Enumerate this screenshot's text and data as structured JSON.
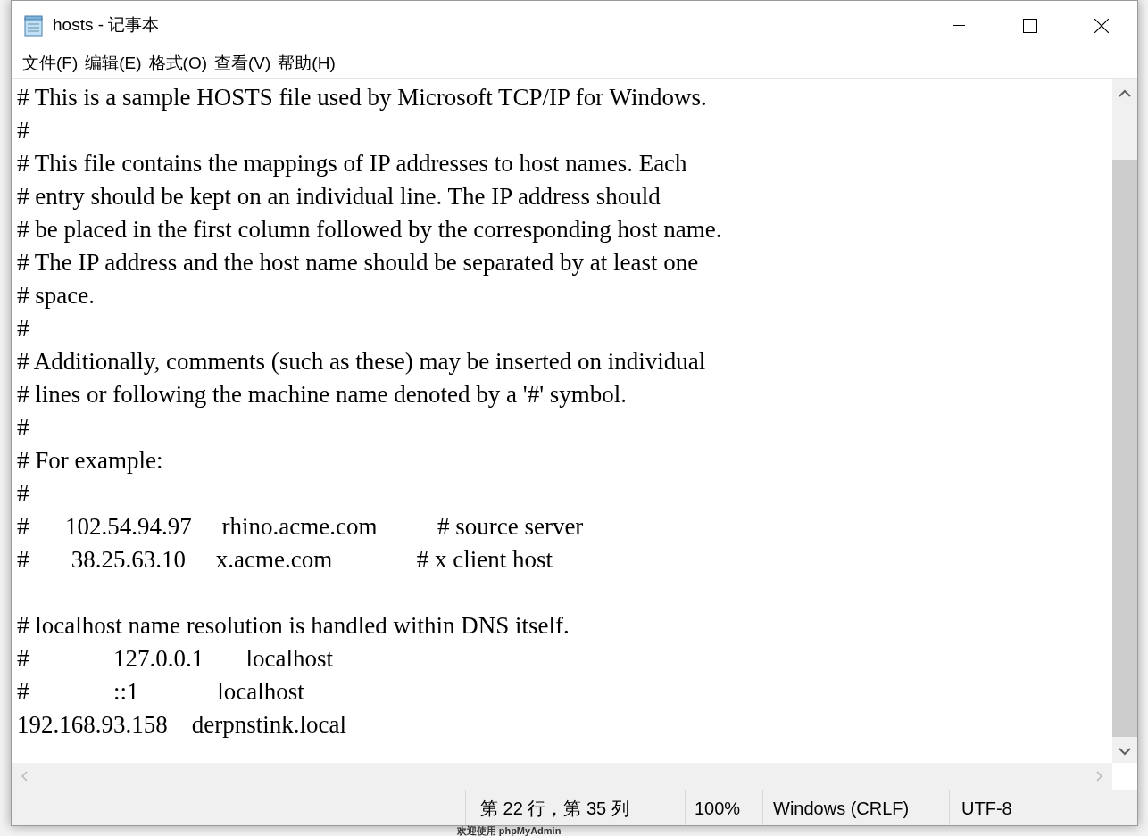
{
  "window": {
    "title": "hosts - 记事本"
  },
  "menu": [
    {
      "label": "文件(F)"
    },
    {
      "label": "编辑(E)"
    },
    {
      "label": "格式(O)"
    },
    {
      "label": "查看(V)"
    },
    {
      "label": "帮助(H)"
    }
  ],
  "editor": {
    "lines": [
      {
        "kind": "text",
        "text": "# This is a sample HOSTS file used by Microsoft TCP/IP for Windows."
      },
      {
        "kind": "text",
        "text": "#"
      },
      {
        "kind": "text",
        "text": "# This file contains the mappings of IP addresses to host names. Each"
      },
      {
        "kind": "text",
        "text": "# entry should be kept on an individual line. The IP address should"
      },
      {
        "kind": "text",
        "text": "# be placed in the first column followed by the corresponding host name."
      },
      {
        "kind": "text",
        "text": "# The IP address and the host name should be separated by at least one"
      },
      {
        "kind": "text",
        "text": "# space."
      },
      {
        "kind": "text",
        "text": "#"
      },
      {
        "kind": "text",
        "text": "# Additionally, comments (such as these) may be inserted on individual"
      },
      {
        "kind": "text",
        "text": "# lines or following the machine name denoted by a '#' symbol."
      },
      {
        "kind": "text",
        "text": "#"
      },
      {
        "kind": "text",
        "text": "# For example:"
      },
      {
        "kind": "text",
        "text": "#"
      },
      {
        "kind": "text",
        "text": "#      102.54.94.97     rhino.acme.com          # source server"
      },
      {
        "kind": "text",
        "text": "#       38.25.63.10     x.acme.com              # x client host"
      },
      {
        "kind": "blank"
      },
      {
        "kind": "text",
        "text": "# localhost name resolution is handled within DNS itself."
      },
      {
        "kind": "text",
        "text": "#              127.0.0.1       localhost"
      },
      {
        "kind": "text",
        "text": "#              ::1             localhost"
      },
      {
        "kind": "text",
        "text": "192.168.93.158    derpnstink.local"
      }
    ]
  },
  "status_bar": {
    "position": "第 22 行，第 35 列",
    "zoom": "100%",
    "line_ending": "Windows (CRLF)",
    "encoding": "UTF-8"
  },
  "background": {
    "caption": "欢迎使用 phpMyAdmin"
  }
}
